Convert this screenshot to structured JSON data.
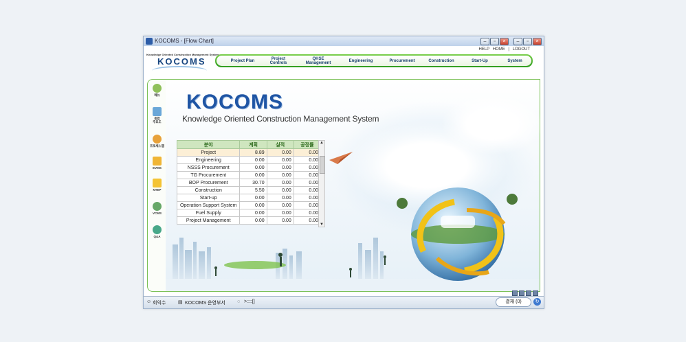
{
  "window": {
    "title": "KOCOMS - [Flow Chart]"
  },
  "top_links": [
    "HELP",
    "HOME",
    "|",
    "LOGOUT"
  ],
  "logo": {
    "subtitle": "Knowledge Oriented Construction Management System",
    "name": "KOCOMS"
  },
  "nav": [
    "Project Plan",
    "Project\nControls",
    "QHSE\nManagement",
    "Engineering",
    "Procurement",
    "Construction",
    "Start-Up",
    "System"
  ],
  "sidebar": [
    {
      "label": "메뉴",
      "icon": "menu-icon",
      "color": "#8fc05a"
    },
    {
      "label": "종합\n주요도",
      "icon": "monitor-icon",
      "color": "#6aa7d8"
    },
    {
      "label": "프로세스맵",
      "icon": "process-map-icon",
      "color": "#e8a23a"
    },
    {
      "label": "EVMS",
      "icon": "evms-icon",
      "color": "#f0b534"
    },
    {
      "label": "NTEP",
      "icon": "ntep-icon",
      "color": "#f4c334"
    },
    {
      "label": "VCMS",
      "icon": "vcms-icon",
      "color": "#67a868"
    },
    {
      "label": "Q&A",
      "icon": "qa-icon",
      "color": "#48a889"
    }
  ],
  "brand": {
    "title": "KOCOMS",
    "subtitle": "Knowledge Oriented Construction Management System"
  },
  "table": {
    "headers": [
      "분야",
      "계획",
      "실적",
      "공정률"
    ],
    "rows": [
      [
        "Project",
        "8.89",
        "0.00",
        "0.00"
      ],
      [
        "Engineering",
        "0.00",
        "0.00",
        "0.00"
      ],
      [
        "NSSS Procurement",
        "0.00",
        "0.00",
        "0.00"
      ],
      [
        "TG Procurement",
        "0.00",
        "0.00",
        "0.00"
      ],
      [
        "BOP Procurement",
        "30.70",
        "0.00",
        "0.00"
      ],
      [
        "Construction",
        "5.50",
        "0.00",
        "0.00"
      ],
      [
        "Start-up",
        "0.00",
        "0.00",
        "0.00"
      ],
      [
        "Operation Support System",
        "0.00",
        "0.00",
        "0.00"
      ],
      [
        "Fuel Supply",
        "0.00",
        "0.00",
        "0.00"
      ],
      [
        "Project Management",
        "0.00",
        "0.00",
        "0.00"
      ]
    ]
  },
  "status_bar": {
    "user": "회익수",
    "department": "KOCOMS 운영부서",
    "chat": ">::::[]",
    "payment": "결재 (0)"
  }
}
